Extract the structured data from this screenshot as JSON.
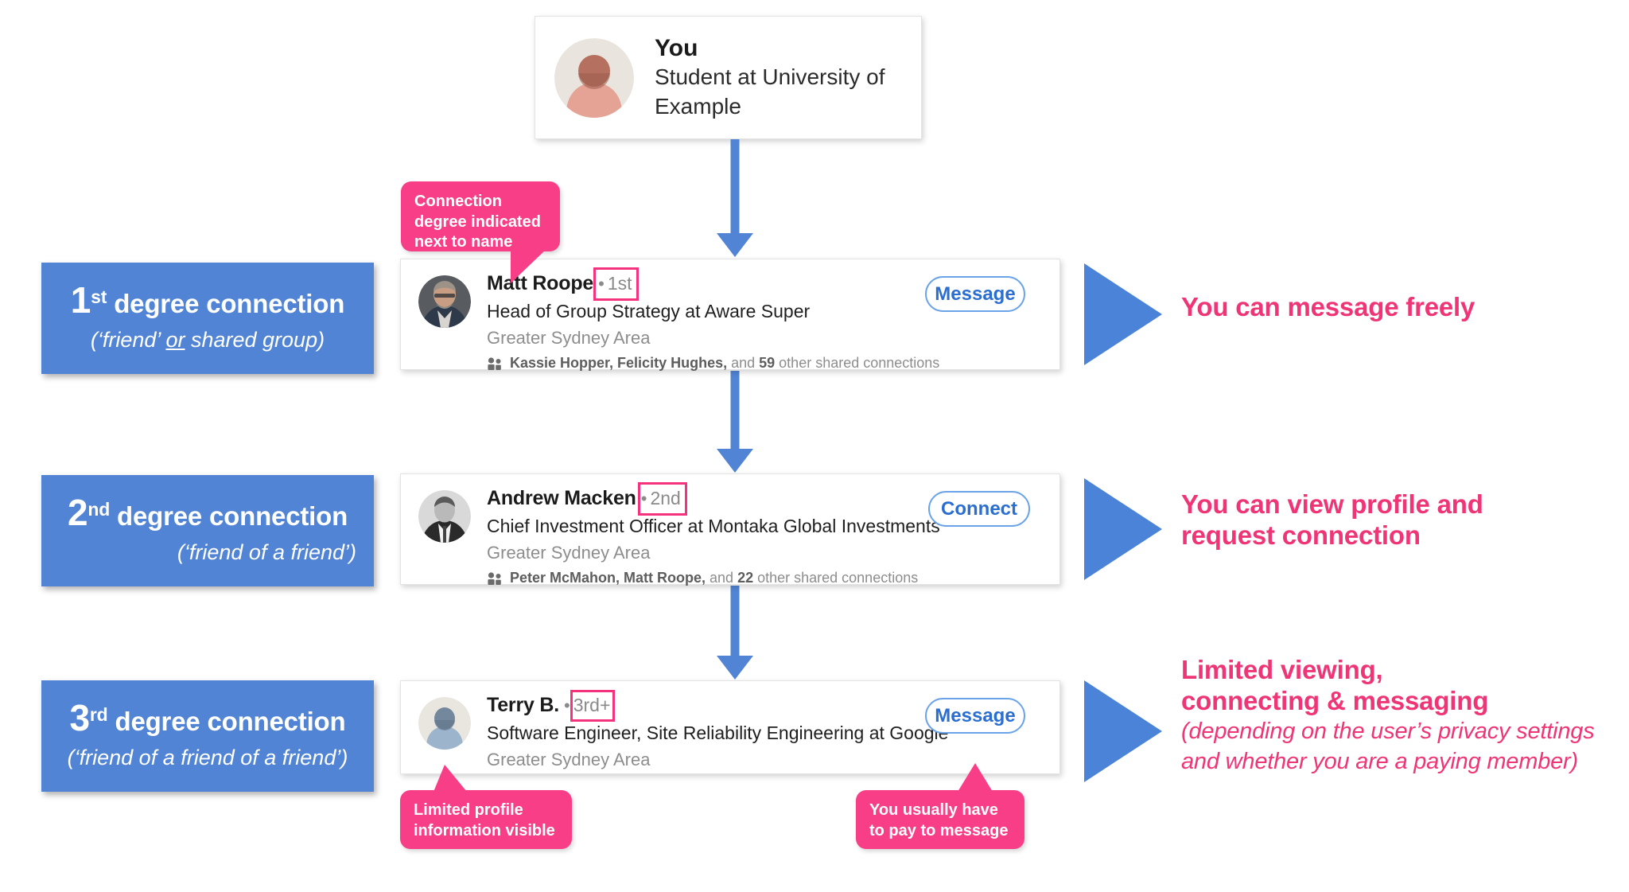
{
  "you_card": {
    "name": "You",
    "role": "Student at University of Example",
    "avatar_icon": "person-avatar-icon"
  },
  "degree_labels": [
    {
      "number": "1",
      "ordinal": "st",
      "title_rest": " degree connection",
      "sub_prefix": "(‘friend’ ",
      "sub_underlined": "or",
      "sub_suffix": " shared group)"
    },
    {
      "number": "2",
      "ordinal": "nd",
      "title_rest": " degree connection",
      "sub_full": "(‘friend of a friend’)"
    },
    {
      "number": "3",
      "ordinal": "rd",
      "title_rest": " degree connection",
      "sub_full": "(‘friend of a friend of a friend’)"
    }
  ],
  "people": [
    {
      "name": "Matt Roope",
      "degree": "1st",
      "separator": "•",
      "role": "Head of Group Strategy at Aware Super",
      "location": "Greater Sydney Area",
      "shared_names": "Kassie Hopper, Felicity Hughes,",
      "shared_mid": " and ",
      "shared_count": "59",
      "shared_suffix": " other shared connections",
      "cta": "Message",
      "avatar_icon": "photo-avatar-matt-roope"
    },
    {
      "name": "Andrew Macken",
      "degree": "2nd",
      "separator": "•",
      "role": "Chief Investment Officer at Montaka Global Investments",
      "location": "Greater Sydney Area",
      "shared_names": "Peter McMahon, Matt Roope,",
      "shared_mid": " and ",
      "shared_count": "22",
      "shared_suffix": " other shared connections",
      "cta": "Connect",
      "avatar_icon": "photo-avatar-andrew-macken"
    },
    {
      "name": "Terry B.",
      "degree": "3rd+",
      "separator": "•",
      "role": "Software Engineer, Site Reliability Engineering at Google",
      "location": "Greater Sydney Area",
      "cta": "Message",
      "avatar_icon": "placeholder-avatar-icon"
    }
  ],
  "outcomes": [
    {
      "line1": "You can message freely"
    },
    {
      "line1": "You can view profile and",
      "line2": "request connection"
    },
    {
      "line1": "Limited viewing,",
      "line2": "connecting & messaging",
      "italic1": "(depending on the user’s privacy settings",
      "italic2": "and whether you are a paying member)"
    }
  ],
  "callouts": [
    {
      "line1": "Connection",
      "line2": "degree indicated",
      "line3": "next to name"
    },
    {
      "line1": "Limited profile",
      "line2": "information visible"
    },
    {
      "line1": "You usually have",
      "line2": "to pay to message"
    }
  ],
  "colors": {
    "blue": "#5184d4",
    "blue_triangle": "#4a83d8",
    "pink": "#f73e86",
    "pink_text": "#ef3576",
    "highlight_border": "#f5327e",
    "cta_border": "#6aa3e8",
    "cta_text": "#2b6ed1",
    "muted_text": "#8d8d8d"
  }
}
